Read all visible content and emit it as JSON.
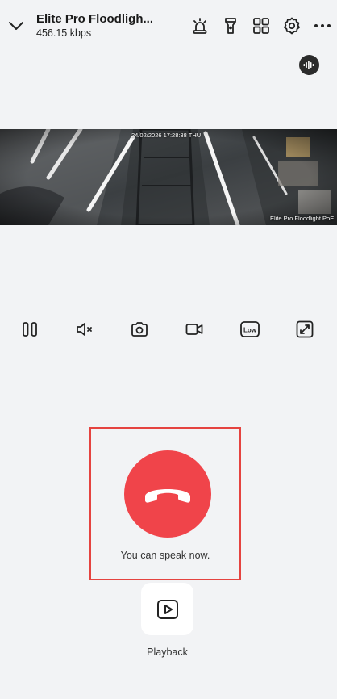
{
  "header": {
    "device_name": "Elite Pro Floodligh...",
    "bitrate": "456.15 kbps"
  },
  "video": {
    "timestamp": "24/02/2026 17:28:38 THU",
    "camera_label": "Elite Pro Floodlight PoE"
  },
  "call": {
    "status_text": "You can speak now.",
    "hangup_color": "#f0444a",
    "frame_color": "#e5433f"
  },
  "playback": {
    "label": "Playback"
  },
  "icons": {
    "header": [
      "chevron-down-icon",
      "siren-icon",
      "flashlight-icon",
      "grid-view-icon",
      "settings-icon",
      "more-icon"
    ],
    "controls": [
      "pause-icon",
      "mute-icon",
      "snapshot-icon",
      "record-icon",
      "quality-low-icon",
      "fullscreen-icon"
    ],
    "quality_badge": "Low"
  }
}
